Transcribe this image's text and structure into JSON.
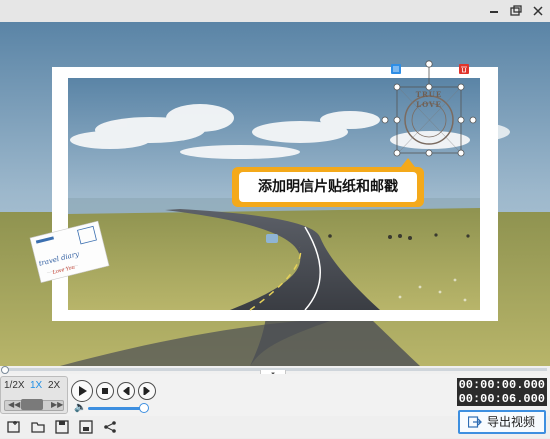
{
  "window": {
    "minimize_icon": "minimize-icon",
    "restore_icon": "restore-icon",
    "close_icon": "close-icon"
  },
  "preview": {
    "callout_text": "添加明信片贴纸和邮戳",
    "stamp_text_top": "TRUE",
    "stamp_text_bottom": "LOVE",
    "postcard_title": "travel diary",
    "postcard_sub": "Love You"
  },
  "playback": {
    "speeds": [
      "1/2X",
      "1X",
      "2X"
    ],
    "active_speed": "1X",
    "current_time": "00:00:00.000",
    "total_time": "00:00:06.000",
    "position_fraction": 0.0,
    "volume_fraction": 0.95
  },
  "toolbar": {
    "export_label": "导出视频",
    "icons": [
      "add-image-icon",
      "open-folder-icon",
      "save-icon",
      "save-as-icon",
      "share-icon"
    ]
  },
  "colors": {
    "accent": "#3d8fe0",
    "callout": "#f4a91a",
    "delete": "#e0342b"
  }
}
